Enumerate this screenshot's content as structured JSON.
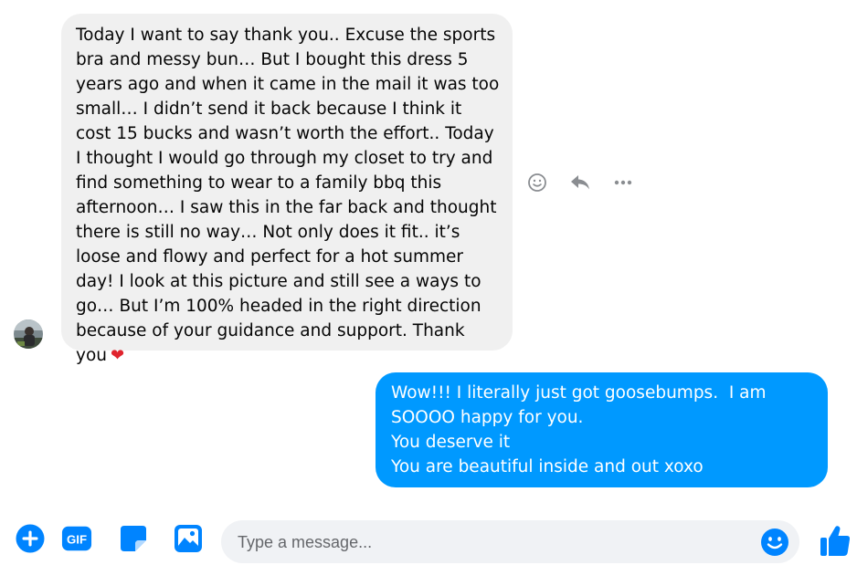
{
  "conversation": {
    "incoming": {
      "text": "Today I want to say thank you.. Excuse the sports bra and messy bun… But I bought this dress 5 years ago and when it came in the mail it was too small… I didn’t send it back because I think it cost 15 bucks and wasn’t worth the effort.. Today I thought I would go through my closet to try and find something to wear to a family bbq this afternoon… I saw this in the far back and thought there is still no way… Not only does it fit.. it’s loose and flowy and perfect for a hot summer day! I look at this picture and still see a ways to go… But I’m 100% headed in the right direction because of your guidance and support. Thank you",
      "emoji": "❤"
    },
    "outgoing": {
      "lines": [
        "Wow!!! I literally just got goosebumps.  I am",
        "SOOOO happy for you.",
        "You deserve it",
        "You are beautiful inside and out xoxo"
      ]
    },
    "hover_actions": [
      "react-icon",
      "reply-icon",
      "more-icon"
    ]
  },
  "composer": {
    "tools": [
      "plus-icon",
      "gif-icon",
      "sticker-icon",
      "image-icon"
    ],
    "gif_label": "GIF",
    "placeholder": "Type a message...",
    "value": "",
    "emoji_icon": "smile-icon",
    "send_icon": "thumbs-up-icon"
  },
  "colors": {
    "accent": "#0084ff",
    "outgoing_bubble": "#0099ff",
    "incoming_bubble": "#f0f0f0",
    "input_bg": "#f0f2f5",
    "icon_gray": "#8a8d91",
    "heart": "#e0242e"
  }
}
